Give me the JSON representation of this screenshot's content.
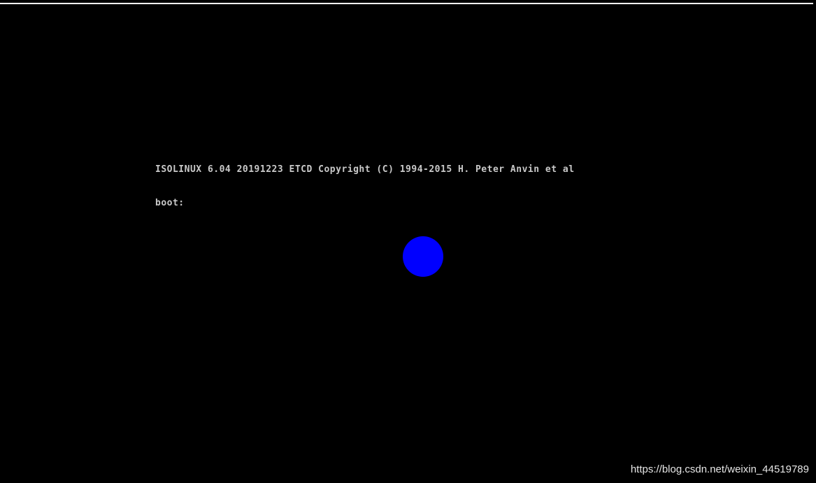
{
  "console": {
    "line1": "ISOLINUX 6.04 20191223 ETCD Copyright (C) 1994-2015 H. Peter Anvin et al",
    "boot_label": "boot:",
    "boot_value": ""
  },
  "indicator": {
    "icon": "blue-circle-icon",
    "color": "#0000ff"
  },
  "watermark": {
    "text": "https://blog.csdn.net/weixin_44519789"
  },
  "colors": {
    "background": "#000000",
    "console_text": "#c9c9c9",
    "top_rule": "#ffffff"
  }
}
